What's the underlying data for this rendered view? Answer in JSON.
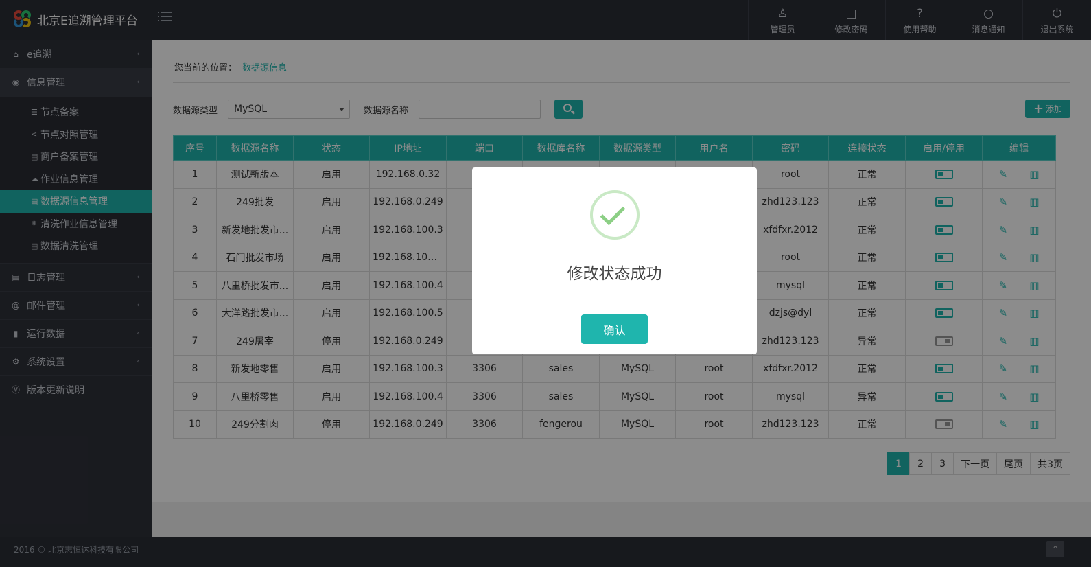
{
  "app": {
    "title": "北京E追溯管理平台"
  },
  "top_nav": [
    {
      "label": "管理员",
      "icon": "user-icon",
      "glyph": "♙"
    },
    {
      "label": "修改密码",
      "icon": "lock-icon",
      "glyph": "🔒"
    },
    {
      "label": "使用帮助",
      "icon": "help-icon",
      "glyph": "?"
    },
    {
      "label": "消息通知",
      "icon": "bell-icon",
      "glyph": "🔔"
    },
    {
      "label": "退出系统",
      "icon": "power-icon",
      "glyph": "⏻"
    }
  ],
  "sidebar": {
    "items": [
      {
        "label": "e追溯",
        "icon": "home-icon",
        "glyph": "⌂"
      },
      {
        "label": "信息管理",
        "icon": "chat-icon",
        "glyph": "💬"
      },
      {
        "label": "日志管理",
        "icon": "book-icon",
        "glyph": "▤"
      },
      {
        "label": "邮件管理",
        "icon": "at-icon",
        "glyph": "@"
      },
      {
        "label": "运行数据",
        "icon": "bar-chart-icon",
        "glyph": "▮"
      },
      {
        "label": "系统设置",
        "icon": "gear-icon",
        "glyph": "⚙"
      },
      {
        "label": "版本更新说明",
        "icon": "version-icon",
        "glyph": "Ⓥ"
      }
    ],
    "submenu": [
      {
        "label": "节点备案",
        "glyph": "☰"
      },
      {
        "label": "节点对照管理",
        "glyph": "<"
      },
      {
        "label": "商户备案管理",
        "glyph": "▤"
      },
      {
        "label": "作业信息管理",
        "glyph": "☁"
      },
      {
        "label": "数据源信息管理",
        "glyph": "▤"
      },
      {
        "label": "清洗作业信息管理",
        "glyph": "❄"
      },
      {
        "label": "数据清洗管理",
        "glyph": "▤"
      }
    ]
  },
  "breadcrumb": {
    "prefix": "您当前的位置：",
    "current": "数据源信息"
  },
  "filter": {
    "type_label": "数据源类型",
    "type_value": "MySQL",
    "name_label": "数据源名称",
    "name_value": "",
    "add_label": "添加"
  },
  "table": {
    "headers": [
      "序号",
      "数据源名称",
      "状态",
      "IP地址",
      "端口",
      "数据库名称",
      "数据源类型",
      "用户名",
      "密码",
      "连接状态",
      "启用/停用",
      "编辑"
    ],
    "rows": [
      [
        "1",
        "测试新版本",
        "启用",
        "192.168.0.32",
        "",
        "",
        "",
        "",
        "root",
        "正常"
      ],
      [
        "2",
        "249批发",
        "启用",
        "192.168.0.249",
        "",
        "",
        "",
        "",
        "zhd123.123",
        "正常"
      ],
      [
        "3",
        "新发地批发市...",
        "启用",
        "192.168.100.3",
        "",
        "",
        "",
        "",
        "xfdfxr.2012",
        "正常"
      ],
      [
        "4",
        "石门批发市场",
        "启用",
        "192.168.100....",
        "",
        "",
        "",
        "",
        "root",
        "正常"
      ],
      [
        "5",
        "八里桥批发市...",
        "启用",
        "192.168.100.4",
        "",
        "",
        "",
        "",
        "mysql",
        "正常"
      ],
      [
        "6",
        "大洋路批发市...",
        "启用",
        "192.168.100.5",
        "",
        "",
        "",
        "",
        "dzjs@dyl",
        "正常"
      ],
      [
        "7",
        "249屠宰",
        "停用",
        "192.168.0.249",
        "",
        "",
        "",
        "",
        "zhd123.123",
        "异常"
      ],
      [
        "8",
        "新发地零售",
        "启用",
        "192.168.100.3",
        "3306",
        "sales",
        "MySQL",
        "root",
        "xfdfxr.2012",
        "正常"
      ],
      [
        "9",
        "八里桥零售",
        "启用",
        "192.168.100.4",
        "3306",
        "sales",
        "MySQL",
        "root",
        "mysql",
        "异常"
      ],
      [
        "10",
        "249分割肉",
        "停用",
        "192.168.0.249",
        "3306",
        "fengerou",
        "MySQL",
        "root",
        "zhd123.123",
        "正常"
      ]
    ],
    "toggle_states": [
      true,
      true,
      true,
      true,
      true,
      true,
      false,
      true,
      true,
      false
    ]
  },
  "pager": {
    "pages": [
      "1",
      "2",
      "3"
    ],
    "next": "下一页",
    "last": "尾页",
    "total": "共3页",
    "current": 1
  },
  "footer": {
    "copyright": "2016 © 北京志恒达科技有限公司"
  },
  "dialog": {
    "message": "修改状态成功",
    "confirm_label": "确认"
  },
  "colors": {
    "accent": "#1fb5ad",
    "header_bg": "#2b2e36",
    "sidebar_bg": "#2f323a"
  }
}
